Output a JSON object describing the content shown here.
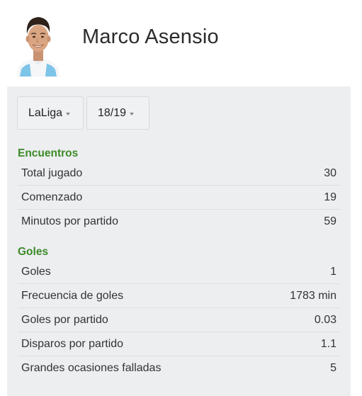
{
  "player": {
    "name": "Marco Asensio"
  },
  "filters": {
    "league": "LaLiga",
    "season": "18/19"
  },
  "sections": [
    {
      "title": "Encuentros",
      "rows": [
        {
          "label": "Total jugado",
          "value": "30"
        },
        {
          "label": "Comenzado",
          "value": "19"
        },
        {
          "label": "Minutos por partido",
          "value": "59"
        }
      ]
    },
    {
      "title": "Goles",
      "rows": [
        {
          "label": "Goles",
          "value": "1"
        },
        {
          "label": "Frecuencia de goles",
          "value": "1783 min"
        },
        {
          "label": "Goles por partido",
          "value": "0.03"
        },
        {
          "label": "Disparos por partido",
          "value": "1.1"
        },
        {
          "label": "Grandes ocasiones falladas",
          "value": "5"
        }
      ]
    }
  ],
  "colors": {
    "section_title": "#3e8a29",
    "panel_bg": "#eceef0",
    "jersey": "#7ec3e8"
  }
}
